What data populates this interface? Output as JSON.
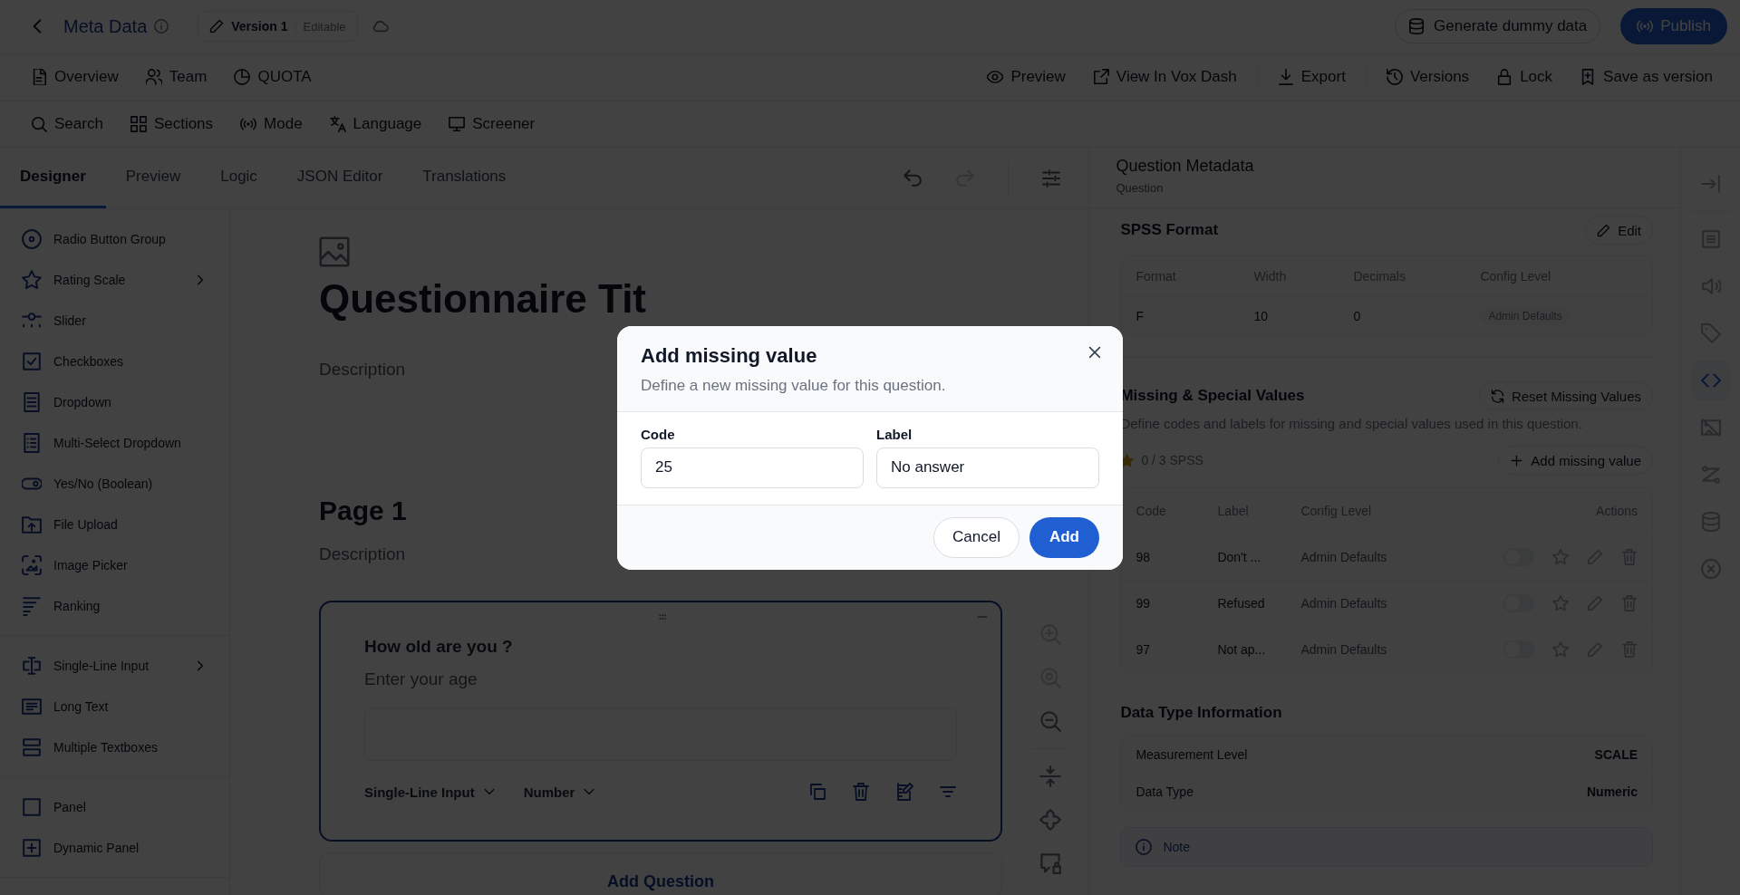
{
  "header": {
    "title": "Meta Data",
    "version": "Version 1",
    "version_status": "Editable",
    "generate": "Generate dummy data",
    "publish": "Publish"
  },
  "nav": {
    "left": [
      "Overview",
      "Team",
      "QUOTA"
    ],
    "right": [
      [
        "Preview",
        "View In Vox Dash"
      ],
      [
        "Export"
      ],
      [
        "Versions",
        "Lock",
        "Save as version"
      ]
    ]
  },
  "tools": [
    "Search",
    "Sections",
    "Mode",
    "Language",
    "Screener"
  ],
  "designer_tabs": [
    {
      "label": "Designer",
      "selected": true
    },
    {
      "label": "Preview",
      "selected": false
    },
    {
      "label": "Logic",
      "selected": false
    },
    {
      "label": "JSON Editor",
      "selected": false
    },
    {
      "label": "Translations",
      "selected": false
    }
  ],
  "palette": [
    {
      "items": [
        {
          "label": "Radio Button Group",
          "submenu": false
        },
        {
          "label": "Rating Scale",
          "submenu": true
        },
        {
          "label": "Slider",
          "submenu": false
        },
        {
          "label": "Checkboxes",
          "submenu": false
        },
        {
          "label": "Dropdown",
          "submenu": false
        },
        {
          "label": "Multi-Select Dropdown",
          "submenu": false
        },
        {
          "label": "Yes/No (Boolean)",
          "submenu": false
        },
        {
          "label": "File Upload",
          "submenu": false
        },
        {
          "label": "Image Picker",
          "submenu": false
        },
        {
          "label": "Ranking",
          "submenu": false
        }
      ]
    },
    {
      "items": [
        {
          "label": "Single-Line Input",
          "submenu": true
        },
        {
          "label": "Long Text",
          "submenu": false
        },
        {
          "label": "Multiple Textboxes",
          "submenu": false
        }
      ]
    },
    {
      "items": [
        {
          "label": "Panel",
          "submenu": false
        },
        {
          "label": "Dynamic Panel",
          "submenu": false
        }
      ]
    }
  ],
  "canvas": {
    "title": "Questionnaire Tit",
    "description": "Description",
    "page": {
      "title": "Page 1",
      "description": "Description"
    },
    "question": {
      "title": "How old are you ?",
      "placeholder": "Enter your age",
      "type": "Single-Line Input",
      "input_type": "Number",
      "selected": true
    },
    "add_question": "Add Question"
  },
  "meta": {
    "title": "Question Metadata",
    "subtitle": "Question",
    "spss": {
      "title": "SPSS Format",
      "edit": "Edit",
      "columns": [
        "Format",
        "Width",
        "Decimals",
        "Config Level"
      ],
      "row": [
        "F",
        "10",
        "0",
        "Admin Defaults"
      ]
    },
    "missing": {
      "title": "Missing & Special Values",
      "reset": "Reset Missing Values",
      "description": "Define codes and labels for missing and special values used in this question.",
      "count": "0 / 3 SPSS",
      "add": "Add missing value",
      "columns": [
        "Code",
        "Label",
        "Config Level",
        "Actions"
      ],
      "rows": [
        {
          "code": "98",
          "label": "Don't ...",
          "config": "Admin Defaults",
          "on": false
        },
        {
          "code": "99",
          "label": "Refused",
          "config": "Admin Defaults",
          "on": false
        },
        {
          "code": "97",
          "label": "Not ap...",
          "config": "Admin Defaults",
          "on": false
        }
      ]
    },
    "data_type": {
      "title": "Data Type Information",
      "rows": [
        {
          "label": "Measurement Level",
          "value": "SCALE"
        },
        {
          "label": "Data Type",
          "value": "Numeric"
        }
      ],
      "note": "Note"
    }
  },
  "rail": [
    {
      "selected": false
    },
    {
      "selected": false
    },
    {
      "selected": false
    },
    {
      "selected": false
    },
    {
      "selected": true
    },
    {
      "selected": false
    },
    {
      "selected": false
    },
    {
      "selected": false
    },
    {
      "selected": false
    }
  ],
  "modal": {
    "title": "Add missing value",
    "description": "Define a new missing value for this question.",
    "fields": [
      {
        "label": "Code",
        "value": "25"
      },
      {
        "label": "Label",
        "value": "No answer"
      }
    ],
    "cancel": "Cancel",
    "submit": "Add"
  }
}
